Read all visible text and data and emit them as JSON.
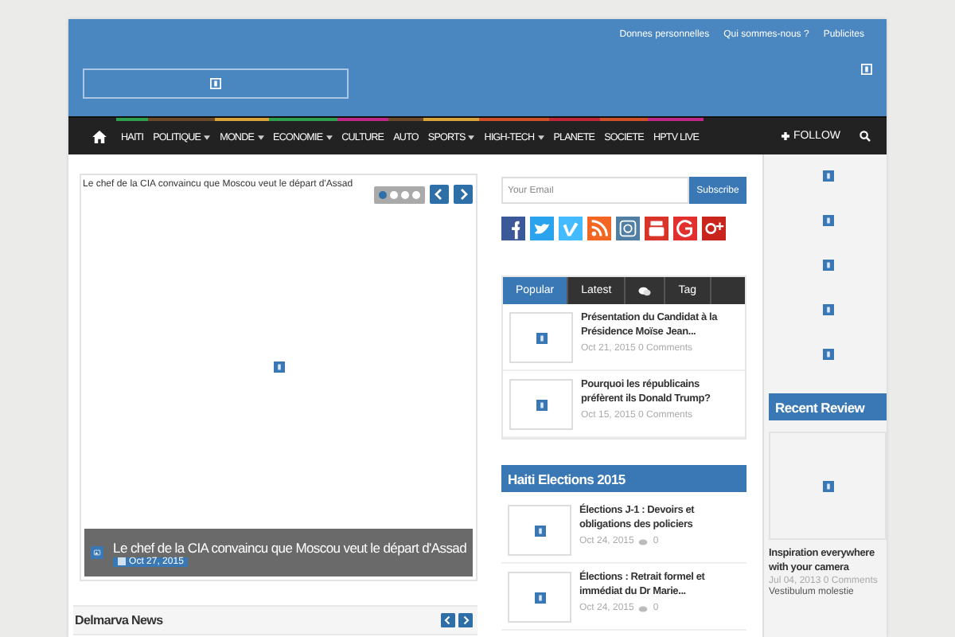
{
  "top_links": [
    "Donnes personnelles",
    "Qui sommes-nous ?",
    "Publicites"
  ],
  "nav": {
    "items": [
      {
        "label": "HAITI",
        "color": "#2e9e4f",
        "has_menu": false
      },
      {
        "label": "POLITIQUE",
        "color": "#6b4a2a",
        "has_menu": true
      },
      {
        "label": "MONDE",
        "color": "#d9a43a",
        "has_menu": true
      },
      {
        "label": "ECONOMIE",
        "color": "#2e9e4f",
        "has_menu": true
      },
      {
        "label": "CULTURE",
        "color": "#c0288a",
        "has_menu": false
      },
      {
        "label": "AUTO",
        "color": "#6b4a2a",
        "has_menu": false
      },
      {
        "label": "SPORTS",
        "color": "#d9a43a",
        "has_menu": true
      },
      {
        "label": "HIGH-TECH",
        "color": "#d0502a",
        "has_menu": true
      },
      {
        "label": "PLANETE",
        "color": "#c0283a",
        "has_menu": false
      },
      {
        "label": "SOCIETE",
        "color": "#d0502a",
        "has_menu": false
      },
      {
        "label": "HPTV LIVE",
        "color": "#c0288a",
        "has_menu": false
      }
    ],
    "follow": "FOLLOW"
  },
  "slider": {
    "heading": "Le chef de la CIA convaincu que Moscou veut le départ d'Assad",
    "dots": [
      {
        "selected": true
      },
      {
        "selected": false
      },
      {
        "selected": false
      },
      {
        "selected": false
      }
    ],
    "caption": "Le chef de la CIA convaincu que Moscou veut le départ d'Assad",
    "date": "Oct 27, 2015"
  },
  "delmarva": "Delmarva News",
  "subscribe": {
    "placeholder": "Your Email",
    "button": "Subscribe"
  },
  "social": [
    {
      "kind": "facebook"
    },
    {
      "kind": "twitter"
    },
    {
      "kind": "vimeo"
    },
    {
      "kind": "rss"
    },
    {
      "kind": "instagram"
    },
    {
      "kind": "youtube"
    },
    {
      "kind": "google"
    },
    {
      "kind": "gplus"
    }
  ],
  "tabs": [
    {
      "kind": "text",
      "label": "Popular",
      "selected": true
    },
    {
      "kind": "text",
      "label": "Latest",
      "selected": false
    },
    {
      "kind": "chat",
      "selected": false
    },
    {
      "kind": "text",
      "label": "Tag",
      "selected": false
    }
  ],
  "popular": [
    {
      "title": "Présentation du Candidat à la Présidence Moïse Jean...",
      "date": "Oct 21, 2015",
      "comments": "0 Comments"
    },
    {
      "title": "Pourquoi les républicains préfèrent ils Donald Trump?",
      "date": "Oct 15, 2015",
      "comments": "0 Comments"
    }
  ],
  "elections": {
    "title": "Haiti Elections 2015",
    "posts": [
      {
        "title": "Élections J-1 : Devoirs et obligations des policiers",
        "date": "Oct 24, 2015",
        "comments": "0"
      },
      {
        "title": "Élections : Retrait formel et immédiat du Dr Marie...",
        "date": "Oct 24, 2015",
        "comments": "0"
      }
    ]
  },
  "recent_review": {
    "title": "Recent Review",
    "post_title": "Inspiration everywhere with your camera",
    "date": "Jul 04, 2013",
    "comments": "0 Comments",
    "excerpt": "Vestibulum molestie"
  }
}
